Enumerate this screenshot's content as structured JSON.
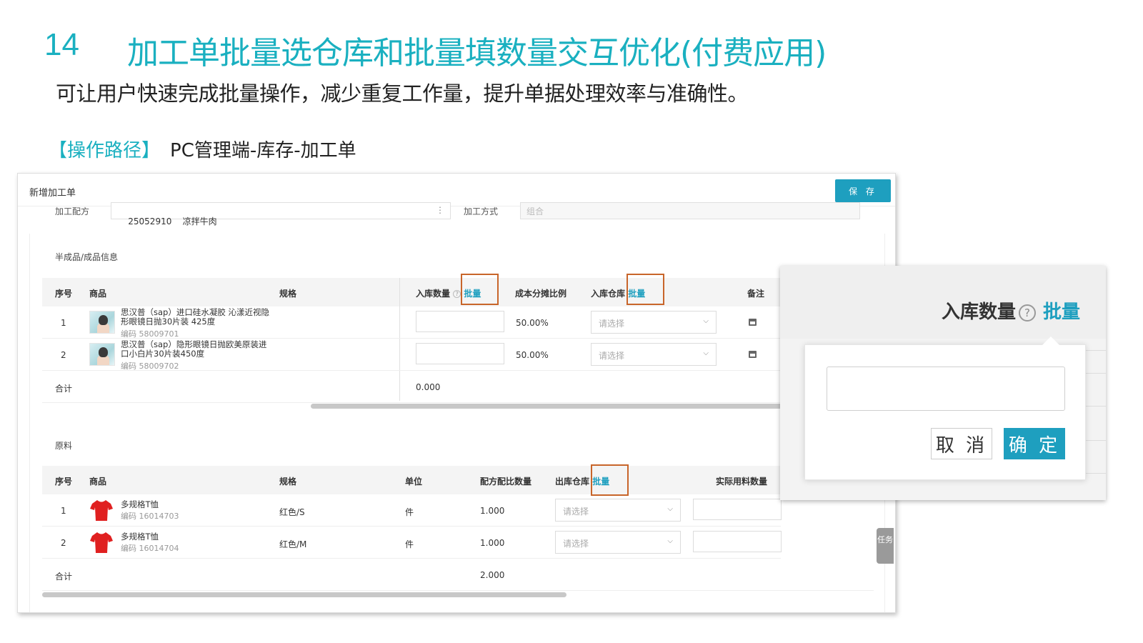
{
  "slide": {
    "number": "14",
    "title": "加工单批量选仓库和批量填数量交互优化(付费应用)",
    "subtitle": "可让用户快速完成批量操作，减少重复工作量，提升单据处理效率与准确性。",
    "path_tag": "【操作路径】",
    "path_text": "PC管理端-库存-加工单"
  },
  "screen": {
    "title": "新增加工单",
    "save_label": "保 存",
    "recipe_label": "加工配方",
    "recipe_value": "25052910    凉拌牛肉",
    "method_label": "加工方式",
    "method_placeholder": "组合",
    "section1_label": "半成品/成品信息",
    "section2_label": "原料",
    "t1_headers": {
      "seq": "序号",
      "goods": "商品",
      "spec": "规格",
      "in_qty": "入库数量",
      "batch1": "批量",
      "cost_ratio": "成本分摊比例",
      "in_wh": "入库仓库",
      "batch2": "批量",
      "remark": "备注"
    },
    "t1_rows": [
      {
        "seq": "1",
        "name": "思汉普（sap）进口硅水凝胶 沁漾近视隐形眼镜日抛30片装 425度",
        "code": "编码  58009701",
        "ratio": "50.00%",
        "wh_placeholder": "请选择"
      },
      {
        "seq": "2",
        "name": "思汉普（sap）隐形眼镜日抛欧美原装进口小白片30片装450度",
        "code": "编码  58009702",
        "ratio": "50.00%",
        "wh_placeholder": "请选择"
      }
    ],
    "t1_total_label": "合计",
    "t1_total_value": "0.000",
    "t2_headers": {
      "seq": "序号",
      "goods": "商品",
      "spec": "规格",
      "unit": "单位",
      "recipe_qty": "配方配比数量",
      "out_wh": "出库仓库",
      "batch": "批量",
      "actual_qty": "实际用料数量"
    },
    "t2_rows": [
      {
        "seq": "1",
        "name": "多规格T恤",
        "code": "编码  16014703",
        "spec": "红色/S",
        "unit": "件",
        "qty": "1.000",
        "wh_placeholder": "请选择"
      },
      {
        "seq": "2",
        "name": "多规格T恤",
        "code": "编码  16014704",
        "spec": "红色/M",
        "unit": "件",
        "qty": "1.000",
        "wh_placeholder": "请选择"
      }
    ],
    "t2_total_label": "合计",
    "t2_total_value": "2.000",
    "task_tab": "任务"
  },
  "zoom": {
    "label": "入库数量",
    "help": "?",
    "batch": "批量",
    "cancel": "取 消",
    "confirm": "确 定"
  },
  "colors": {
    "accent": "#1ab0c0",
    "primary_button": "#1e9fbf",
    "highlight_box": "#c8652a",
    "tshirt": "#e02020"
  }
}
